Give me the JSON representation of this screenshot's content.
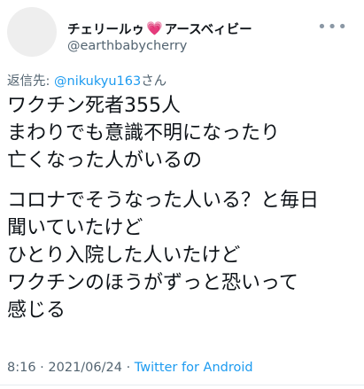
{
  "author": {
    "display_name_prefix": "チェリールゥ",
    "heart_emoji": "💗",
    "display_name_suffix": "アースベィビー",
    "handle": "@earthbabycherry"
  },
  "reply_to": {
    "label": "返信先: ",
    "handle": "@nikukyu163",
    "suffix": "さん"
  },
  "body": {
    "p1": [
      "ワクチン死者355人",
      "まわりでも意識不明になったり",
      "亡くなった人がいるの"
    ],
    "p2": [
      "コロナでそうなった人いる？と毎日",
      "聞いていたけど",
      "ひとり入院した人いたけど",
      "ワクチンのほうがずっと恐いって",
      "感じる"
    ]
  },
  "meta": {
    "time": "8:16",
    "separator1": " · ",
    "date": "2021/06/24",
    "separator2": " · ",
    "source": "Twitter for Android"
  },
  "more_icon": "•••"
}
